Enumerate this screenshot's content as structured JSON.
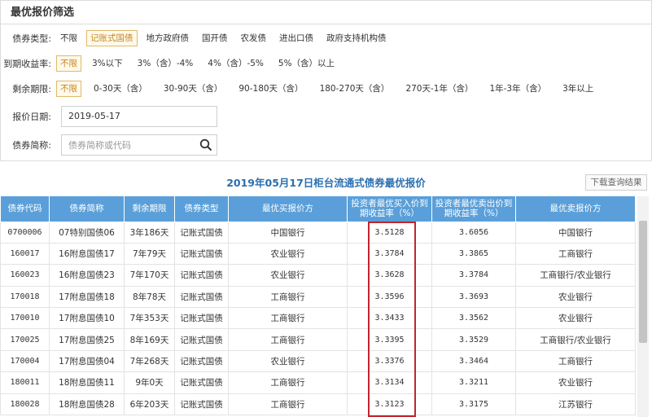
{
  "filters": {
    "title": "最优报价筛选",
    "bond_type": {
      "label": "债券类型:",
      "options": [
        "不限",
        "记账式国债",
        "地方政府债",
        "国开债",
        "农发债",
        "进出口债",
        "政府支持机构债"
      ],
      "selected": "记账式国债"
    },
    "yield": {
      "label": "到期收益率:",
      "options": [
        "不限",
        "3%以下",
        "3%（含）-4%",
        "4%（含）-5%",
        "5%（含）以上"
      ],
      "selected": "不限"
    },
    "remaining": {
      "label": "剩余期限:",
      "options": [
        "不限",
        "0-30天（含）",
        "30-90天（含）",
        "90-180天（含）",
        "180-270天（含）",
        "270天-1年（含）",
        "1年-3年（含）",
        "3年以上"
      ],
      "selected": "不限"
    },
    "date": {
      "label": "报价日期:",
      "value": "2019-05-17"
    },
    "search": {
      "label": "债券简称:",
      "placeholder": "债券简称或代码"
    }
  },
  "table": {
    "title": "2019年05月17日柜台流通式债券最优报价",
    "download_label": "下载查询结果",
    "headers": [
      "债券代码",
      "债券简称",
      "剩余期限",
      "债券类型",
      "最优买报价方",
      "投资者最优买入价到期收益率（%）",
      "投资者最优卖出价到期收益率（%）",
      "最优卖报价方"
    ],
    "rows": [
      [
        "0700006",
        "07特别国债06",
        "3年186天",
        "记账式国债",
        "中国银行",
        "3.5128",
        "3.6056",
        "中国银行"
      ],
      [
        "160017",
        "16附息国债17",
        "7年79天",
        "记账式国债",
        "农业银行",
        "3.3784",
        "3.3865",
        "工商银行"
      ],
      [
        "160023",
        "16附息国债23",
        "7年170天",
        "记账式国债",
        "农业银行",
        "3.3628",
        "3.3784",
        "工商银行/农业银行"
      ],
      [
        "170018",
        "17附息国债18",
        "8年78天",
        "记账式国债",
        "工商银行",
        "3.3596",
        "3.3693",
        "农业银行"
      ],
      [
        "170010",
        "17附息国债10",
        "7年353天",
        "记账式国债",
        "工商银行",
        "3.3433",
        "3.3562",
        "农业银行"
      ],
      [
        "170025",
        "17附息国债25",
        "8年169天",
        "记账式国债",
        "工商银行",
        "3.3395",
        "3.3529",
        "工商银行/农业银行"
      ],
      [
        "170004",
        "17附息国债04",
        "7年268天",
        "记账式国债",
        "农业银行",
        "3.3376",
        "3.3464",
        "工商银行"
      ],
      [
        "180011",
        "18附息国债11",
        "9年0天",
        "记账式国债",
        "工商银行",
        "3.3134",
        "3.3211",
        "农业银行"
      ],
      [
        "180028",
        "18附息国债28",
        "6年203天",
        "记账式国债",
        "工商银行",
        "3.3123",
        "3.3175",
        "江苏银行"
      ]
    ]
  },
  "colors": {
    "header_bg": "#5a9fd9",
    "title_blue": "#2a6fb0",
    "selected_border": "#e0b96a",
    "highlight_red": "#c0262b"
  }
}
